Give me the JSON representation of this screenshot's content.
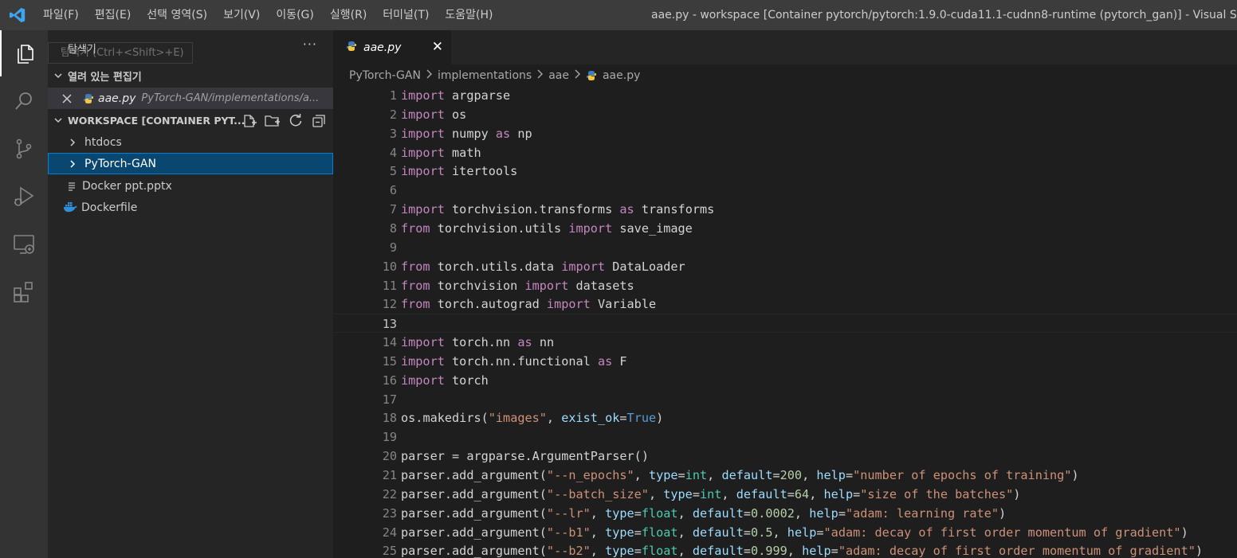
{
  "menu": [
    "파일(F)",
    "편집(E)",
    "선택 영역(S)",
    "보기(V)",
    "이동(G)",
    "실행(R)",
    "터미널(T)",
    "도움말(H)"
  ],
  "window_title": "aae.py - workspace [Container pytorch/pytorch:1.9.0-cuda11.1-cudnn8-runtime (pytorch_gan)] - Visual Studio Code",
  "activity_bar": [
    "explorer-icon",
    "search-icon",
    "source-control-icon",
    "run-debug-icon",
    "remote-explorer-icon",
    "extensions-icon"
  ],
  "sidebar": {
    "title": "탐색기",
    "tooltip": "탐색기 (Ctrl+<Shift>+E)",
    "more": "···",
    "open_editors": {
      "header": "열려 있는 편집기",
      "file_name": "aae.py",
      "file_path": "PyTorch-GAN/implementations/a..."
    },
    "workspace": {
      "header": "WORKSPACE [CONTAINER PYT...",
      "items": [
        {
          "label": "htdocs",
          "kind": "folder"
        },
        {
          "label": "PyTorch-GAN",
          "kind": "folder",
          "selected": true
        },
        {
          "label": "Docker ppt.pptx",
          "kind": "file"
        },
        {
          "label": "Dockerfile",
          "kind": "docker"
        }
      ]
    }
  },
  "editor": {
    "tab": {
      "label": "aae.py",
      "close": "✕"
    },
    "breadcrumb": [
      "PyTorch-GAN",
      "implementations",
      "aae",
      "aae.py"
    ],
    "current_line": 13,
    "lines": [
      "import argparse",
      "import os",
      "import numpy as np",
      "import math",
      "import itertools",
      "",
      "import torchvision.transforms as transforms",
      "from torchvision.utils import save_image",
      "",
      "from torch.utils.data import DataLoader",
      "from torchvision import datasets",
      "from torch.autograd import Variable",
      "",
      "import torch.nn as nn",
      "import torch.nn.functional as F",
      "import torch",
      "",
      "os.makedirs(\"images\", exist_ok=True)",
      "",
      "parser = argparse.ArgumentParser()",
      "parser.add_argument(\"--n_epochs\", type=int, default=200, help=\"number of epochs of training\")",
      "parser.add_argument(\"--batch_size\", type=int, default=64, help=\"size of the batches\")",
      "parser.add_argument(\"--lr\", type=float, default=0.0002, help=\"adam: learning rate\")",
      "parser.add_argument(\"--b1\", type=float, default=0.5, help=\"adam: decay of first order momentum of gradient\")",
      "parser.add_argument(\"--b2\", type=float, default=0.999, help=\"adam: decay of first order momentum of gradient\")"
    ]
  },
  "colors": {
    "keyword": "#c586c0",
    "string": "#ce9178",
    "number": "#b5cea8",
    "builtin_type": "#4ec9b0",
    "constant": "#569cd6",
    "parameter": "#9cdcfe",
    "selection": "#094771",
    "accent": "#007acc"
  }
}
